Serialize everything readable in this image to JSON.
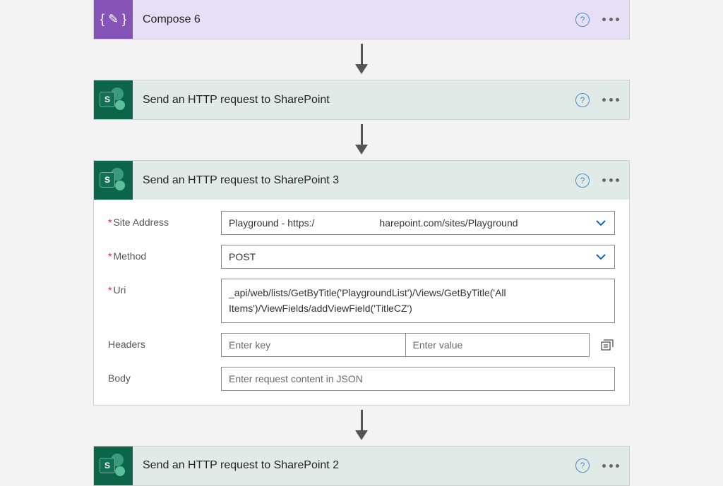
{
  "compose": {
    "title": "Compose 6"
  },
  "httpAction1": {
    "title": "Send an HTTP request to SharePoint"
  },
  "httpAction3": {
    "title": "Send an HTTP request to SharePoint 3",
    "fields": {
      "siteAddress": {
        "label": "Site Address",
        "prefix": "Playground - https:/",
        "suffix": "harepoint.com/sites/Playground"
      },
      "method": {
        "label": "Method",
        "value": "POST"
      },
      "uri": {
        "label": "Uri",
        "value": "_api/web/lists/GetByTitle('PlaygroundList')/Views/GetByTitle('All Items')/ViewFields/addViewField('TitleCZ')"
      },
      "headers": {
        "label": "Headers",
        "keyPlaceholder": "Enter key",
        "valuePlaceholder": "Enter value"
      },
      "body": {
        "label": "Body",
        "placeholder": "Enter request content in JSON"
      }
    }
  },
  "httpAction2": {
    "title": "Send an HTTP request to SharePoint 2"
  }
}
